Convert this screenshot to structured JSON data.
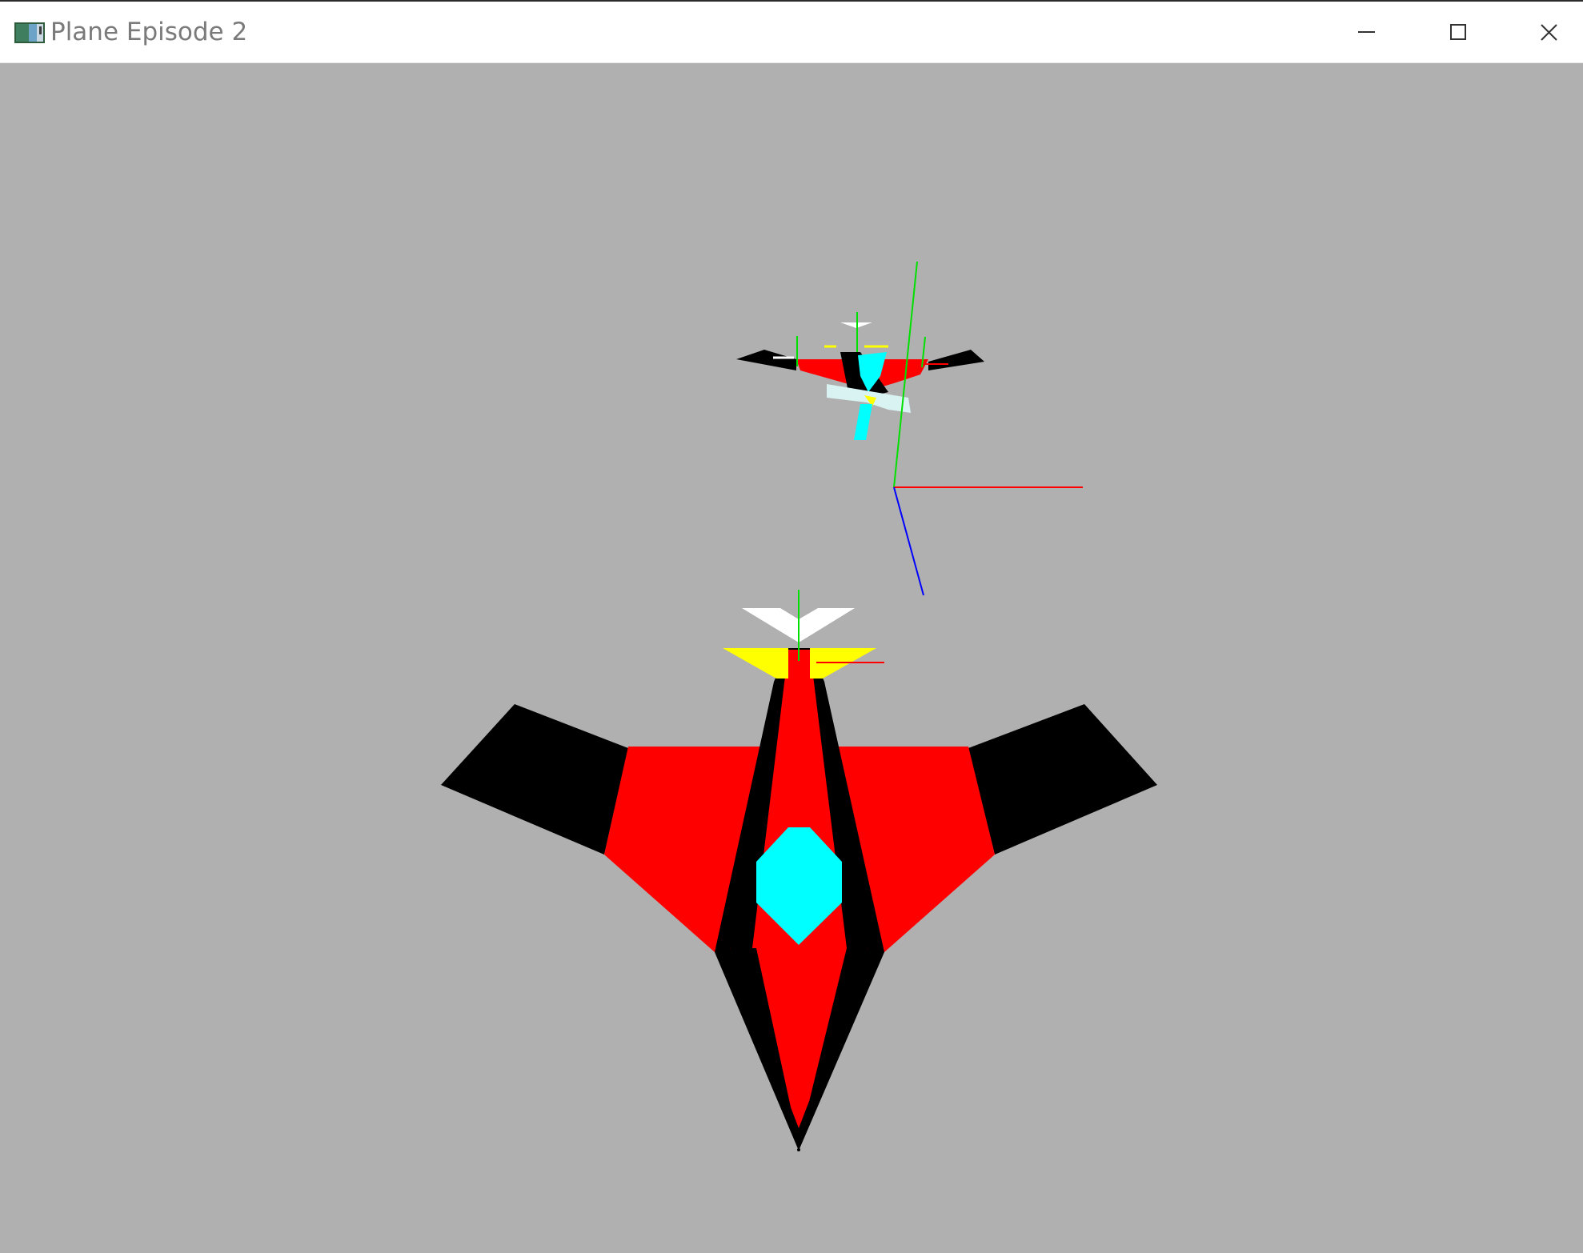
{
  "window": {
    "title": "Plane Episode 2",
    "icon": "opengl-app-icon",
    "controls": {
      "minimize_icon": "minimize-icon",
      "maximize_icon": "maximize-icon",
      "close_icon": "close-icon"
    }
  },
  "viewport": {
    "background_color": "#b0b0b0",
    "objects": [
      {
        "name": "player-plane",
        "colors": [
          "#ff0000",
          "#000000",
          "#00ffff",
          "#ffff00",
          "#ffffff"
        ]
      },
      {
        "name": "enemy-plane",
        "colors": [
          "#ff0000",
          "#000000",
          "#00ffff",
          "#ffff00",
          "#ffffff",
          "#d9f2f2"
        ]
      },
      {
        "name": "coordinate-axes",
        "colors": {
          "x_axis": "#ff0000",
          "y_axis": "#00e000",
          "z_axis": "#0000ff"
        }
      }
    ]
  }
}
